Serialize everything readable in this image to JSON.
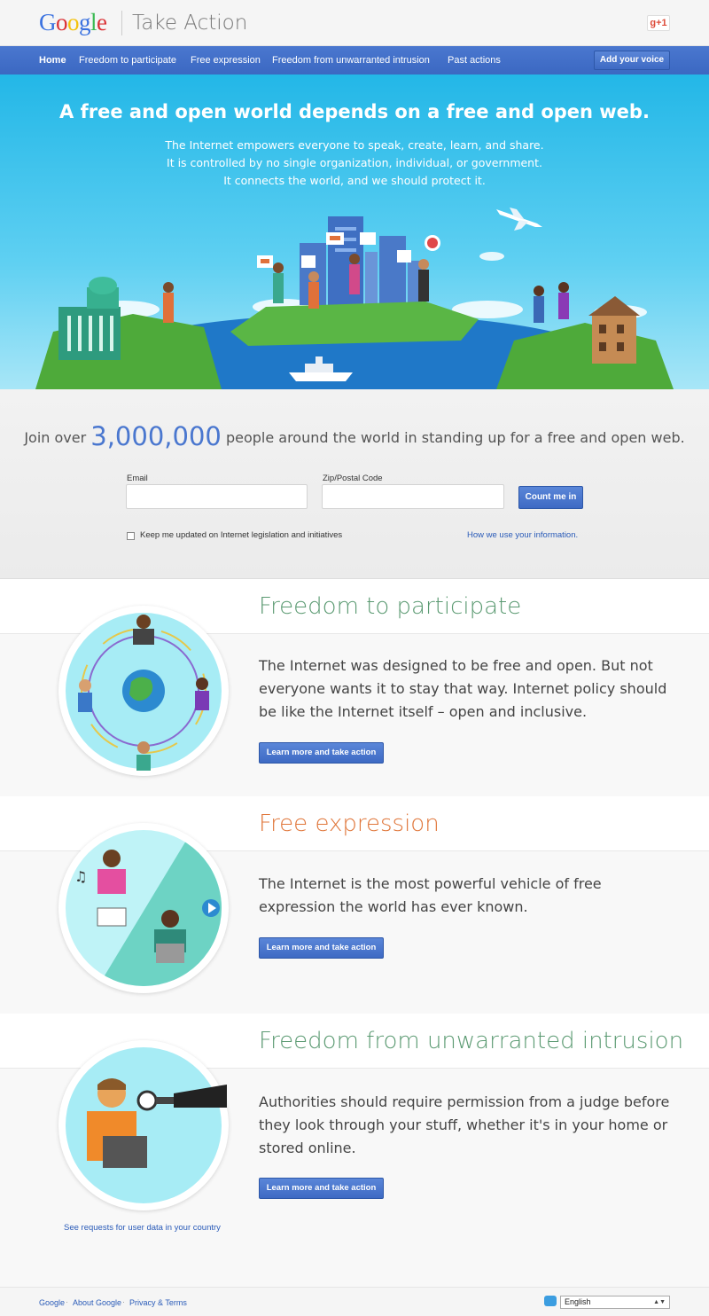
{
  "header": {
    "logo_letters": [
      {
        "ch": "G",
        "color": "#3b72e0"
      },
      {
        "ch": "o",
        "color": "#db3236"
      },
      {
        "ch": "o",
        "color": "#f4c20d"
      },
      {
        "ch": "g",
        "color": "#3b72e0"
      },
      {
        "ch": "l",
        "color": "#3cba54"
      },
      {
        "ch": "e",
        "color": "#db3236"
      }
    ],
    "site_title": "Take Action",
    "gplus_label": "g+1"
  },
  "nav": {
    "items": [
      {
        "label": "Home",
        "active": true
      },
      {
        "label": "Freedom to participate",
        "active": false
      },
      {
        "label": "Free expression",
        "active": false
      },
      {
        "label": "Freedom from unwarranted intrusion",
        "active": false
      },
      {
        "label": "Past actions",
        "active": false
      }
    ],
    "cta_label": "Add your voice"
  },
  "hero": {
    "title": "A free and open world depends on a free and open web.",
    "subtitle_lines": [
      "The Internet empowers everyone to speak, create, learn, and share.",
      "It is controlled by no single organization, individual, or government.",
      "It connects the world, and we should protect it."
    ]
  },
  "signup": {
    "join_prefix": "Join over",
    "join_count": "3,000,000",
    "join_suffix": "people around the world in standing up for a free and open web.",
    "email_label": "Email",
    "email_value": "",
    "zip_label": "Zip/Postal Code",
    "zip_value": "",
    "submit_label": "Count me in",
    "checkbox_label": "Keep me updated on Internet legislation and initiatives",
    "checkbox_checked": false,
    "info_link": "How we use your information."
  },
  "sections": [
    {
      "title": "Freedom to participate",
      "title_color": "#5b9a72",
      "text": "The Internet was designed to be free and open. But not everyone wants it to stay that way. Internet policy should be like the Internet itself – open and inclusive.",
      "cta": "Learn more and take action"
    },
    {
      "title": "Free expression",
      "title_color": "#e0763a",
      "text": "The Internet is the most powerful vehicle of free expression the world has ever known.",
      "cta": "Learn more and take action"
    },
    {
      "title": "Freedom from unwarranted intrusion",
      "title_color": "#5b9a72",
      "text": "Authorities should require permission from a judge before they look through your stuff, whether it's in your home or stored online.",
      "cta": "Learn more and take action",
      "extra_link": "See requests for user data in your country"
    }
  ],
  "footer": {
    "links": [
      "Google",
      "About Google",
      "Privacy & Terms"
    ],
    "language": "English"
  }
}
